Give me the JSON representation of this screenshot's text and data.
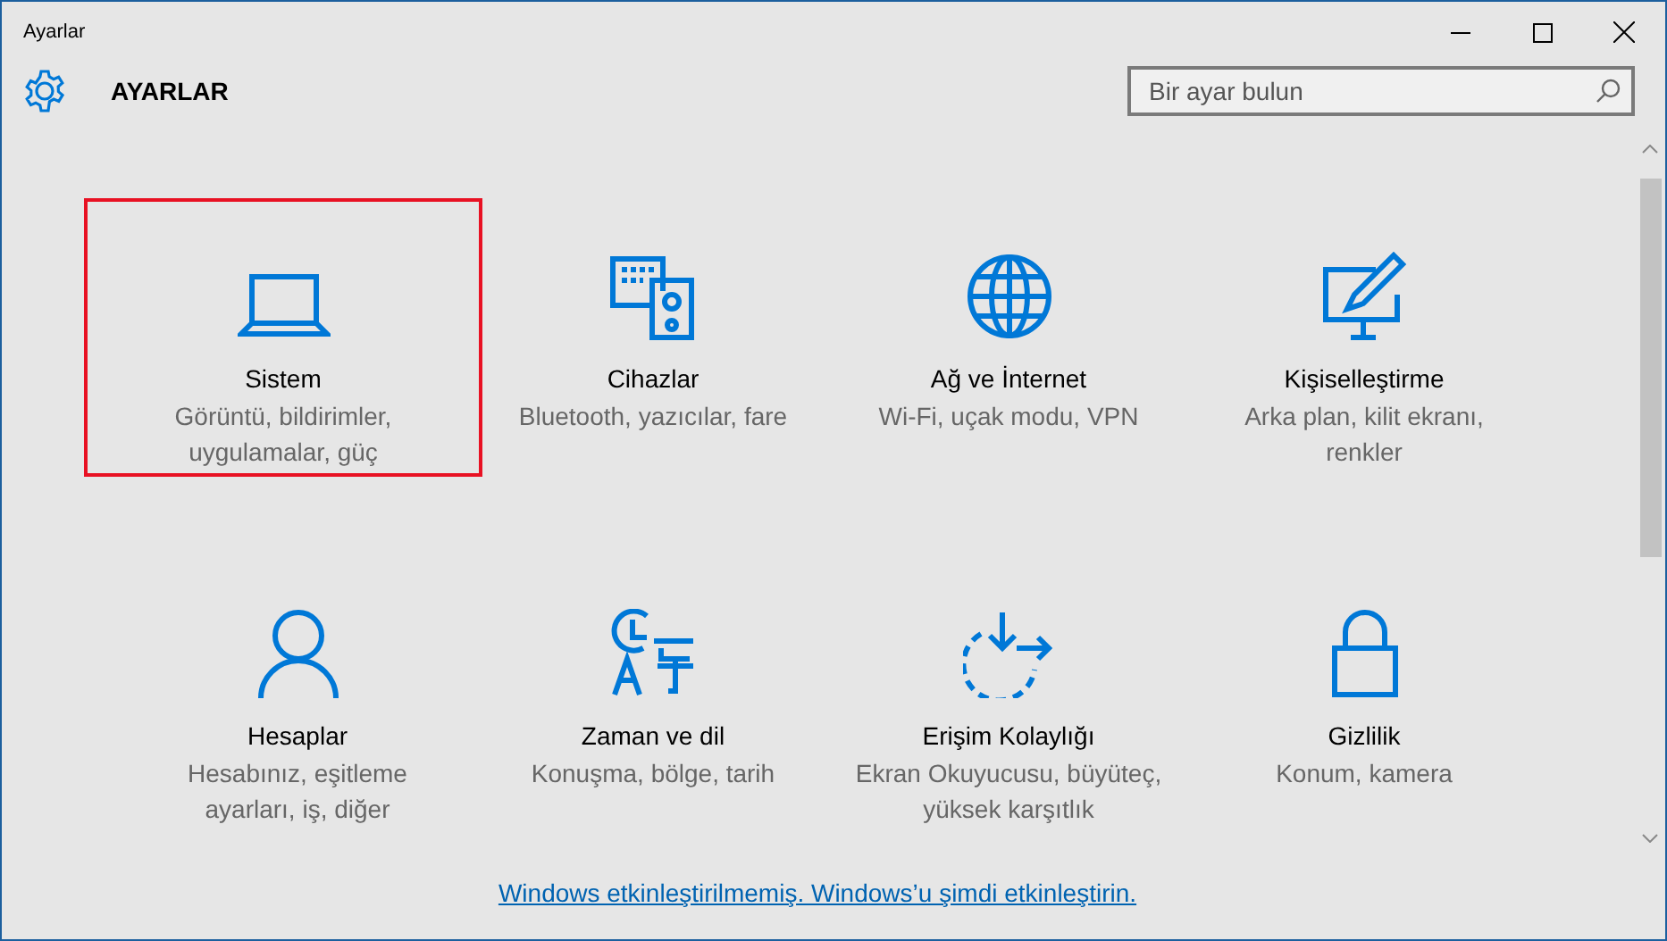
{
  "window": {
    "title": "Ayarlar"
  },
  "header": {
    "title": "AYARLAR"
  },
  "search": {
    "placeholder": "Bir ayar bulun"
  },
  "tiles": [
    {
      "kind": "laptop",
      "title": "Sistem",
      "description": "Görüntü, bildirimler, uygulamalar, güç",
      "highlighted": true
    },
    {
      "kind": "devices",
      "title": "Cihazlar",
      "description": "Bluetooth, yazıcılar, fare",
      "highlighted": false
    },
    {
      "kind": "globe",
      "title": "Ağ ve İnternet",
      "description": "Wi-Fi, uçak modu, VPN",
      "highlighted": false
    },
    {
      "kind": "paint",
      "title": "Kişiselleştirme",
      "description": "Arka plan, kilit ekranı, renkler",
      "highlighted": false
    },
    {
      "kind": "person",
      "title": "Hesaplar",
      "description": "Hesabınız, eşitleme ayarları, iş, diğer",
      "highlighted": false
    },
    {
      "kind": "time",
      "title": "Zaman ve dil",
      "description": "Konuşma, bölge, tarih",
      "highlighted": false
    },
    {
      "kind": "access",
      "title": "Erişim Kolaylığı",
      "description": "Ekran Okuyucusu, büyüteç, yüksek karşıtlık",
      "highlighted": false
    },
    {
      "kind": "lock",
      "title": "Gizlilik",
      "description": "Konum, kamera",
      "highlighted": false
    }
  ],
  "activation_link": "Windows etkinleştirilmemiş. Windows’u şimdi etkinleştirin."
}
